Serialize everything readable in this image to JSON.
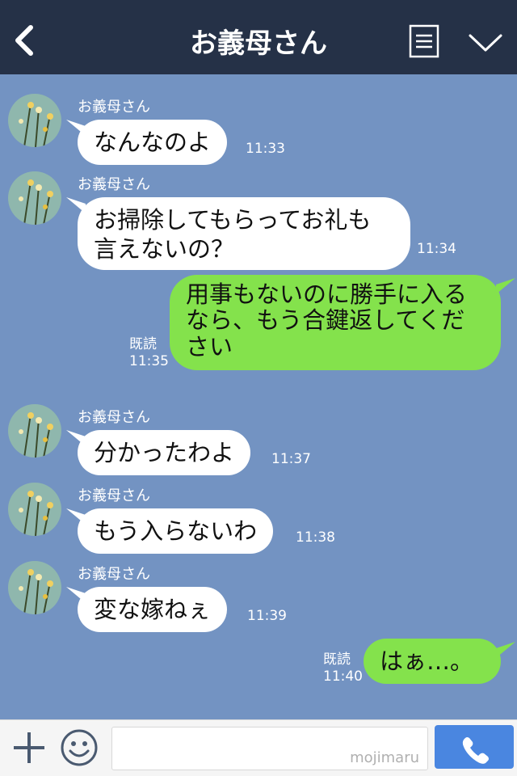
{
  "header": {
    "title": "お義母さん",
    "back_icon": "chevron-left-icon",
    "menu_icon": "list-menu-icon",
    "collapse_icon": "chevron-down-icon"
  },
  "messages": [
    {
      "sender": "お義母さん",
      "text": "なんなのよ",
      "time": "11:33"
    },
    {
      "sender": "お義母さん",
      "text": "お掃除してもらってお礼も\n言えないの？",
      "time": "11:34"
    },
    {
      "text": "用事もないのに勝手に入る\nなら、もう合鍵返してくだ\nさい",
      "read": "既読",
      "time": "11:35"
    },
    {
      "sender": "お義母さん",
      "text": "分かったわよ",
      "time": "11:37"
    },
    {
      "sender": "お義母さん",
      "text": "もう入らないわ",
      "time": "11:38"
    },
    {
      "sender": "お義母さん",
      "text": "変な嫁ねぇ",
      "time": "11:39"
    },
    {
      "text": "はぁ…。",
      "read": "既読",
      "time": "11:40"
    }
  ],
  "footer": {
    "input_placeholder": "",
    "watermark": "mojimaru",
    "plus_icon": "plus-icon",
    "emoji_icon": "smiley-icon",
    "call_icon": "phone-icon"
  },
  "colors": {
    "header_bg": "#253147",
    "chat_bg": "#7393c2",
    "incoming_bubble": "#ffffff",
    "outgoing_bubble": "#84e24c",
    "call_button": "#4a86e0"
  }
}
